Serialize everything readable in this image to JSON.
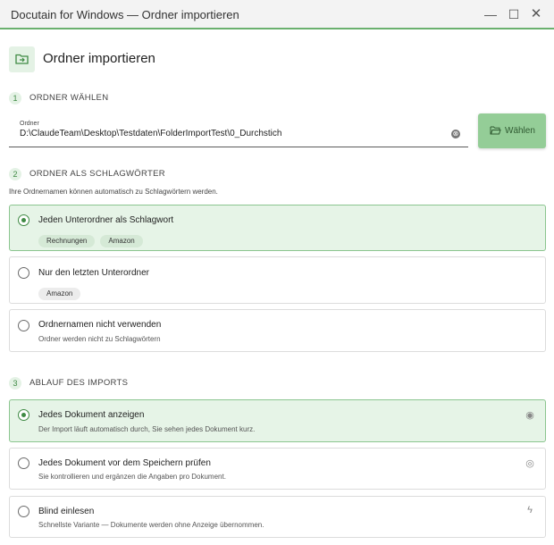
{
  "window": {
    "title": "Docutain for Windows — Ordner importieren",
    "minimize_icon": "—",
    "maximize_icon": "☐",
    "close_icon": "✕"
  },
  "header": {
    "icon": "folder-import-icon",
    "title": "Ordner importieren"
  },
  "step1": {
    "number": "1",
    "label": "ORDNER WÄHLEN",
    "field_caption": "Ordner",
    "field_value": "D:\\ClaudeTeam\\Desktop\\Testdaten\\FolderImportTest\\0_Durchstich",
    "clear_icon": "⊗",
    "choose_button_label": "Wählen"
  },
  "step2": {
    "number": "2",
    "label": "ORDNER ALS SCHLAGWÖRTER",
    "hint": "Ihre Ordnernamen können automatisch zu Schlagwörtern werden.",
    "options": [
      {
        "title": "Jeden Unterordner als Schlagwort",
        "selected": true,
        "chips": [
          "Rechnungen",
          "Amazon"
        ]
      },
      {
        "title": "Nur den letzten Unterordner",
        "selected": false,
        "chips": [
          "Amazon"
        ]
      },
      {
        "title": "Ordnernamen nicht verwenden",
        "selected": false,
        "description": "Ordner werden nicht zu Schlagwörtern"
      }
    ]
  },
  "step3": {
    "number": "3",
    "label": "ABLAUF DES IMPORTS",
    "options": [
      {
        "title": "Jedes Dokument anzeigen",
        "description": "Der Import läuft automatisch durch, Sie sehen jedes Dokument kurz.",
        "selected": true,
        "icon": "eye-icon",
        "glyph": "◉"
      },
      {
        "title": "Jedes Dokument vor dem Speichern prüfen",
        "description": "Sie kontrollieren und ergänzen die Angaben pro Dokument.",
        "selected": false,
        "icon": "eye-check-icon",
        "glyph": "◎"
      },
      {
        "title": "Blind einlesen",
        "description": "Schnellste Variante — Dokumente werden ohne Anzeige übernommen.",
        "selected": false,
        "icon": "lightning-icon",
        "glyph": "ϟ"
      }
    ]
  },
  "colors": {
    "accent": "#3f8a44",
    "accent_light": "#e6f4e7",
    "button": "#94cd97"
  }
}
